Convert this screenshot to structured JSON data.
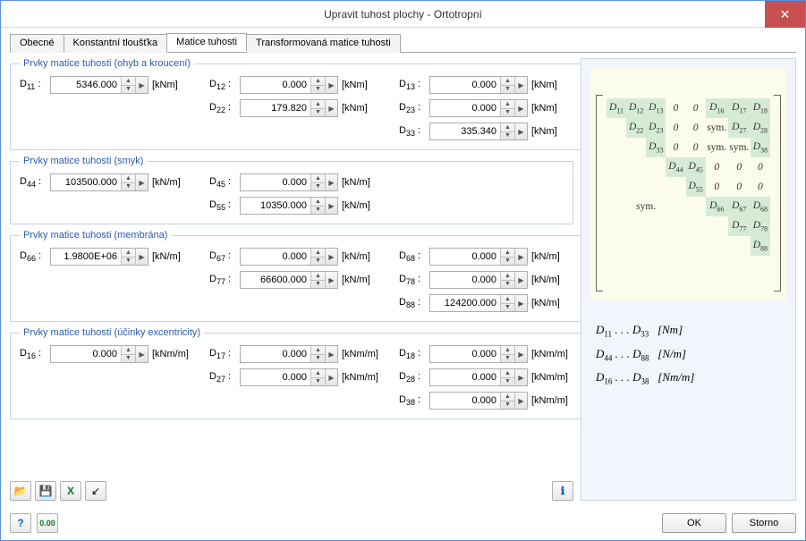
{
  "window": {
    "title": "Upravit tuhost plochy - Ortotropní"
  },
  "tabs": {
    "t0": "Obecné",
    "t1": "Konstantní tloušťka",
    "t2": "Matice tuhosti",
    "t3": "Transformovaná matice tuhosti"
  },
  "groups": {
    "bending": "Prvky matice tuhosti (ohyb a kroucení)",
    "shear": "Prvky matice tuhosti (smyk)",
    "membrane": "Prvky matice tuhosti (membrána)",
    "ecc": "Prvky matice tuhosti (účinky excentricity)"
  },
  "units": {
    "kNm": "[kNm]",
    "kNperm": "[kN/m]",
    "kNmperm": "[kNm/m]"
  },
  "labels": {
    "D11": "D",
    "D12": "D",
    "D13": "D",
    "D22": "D",
    "D23": "D",
    "D33": "D",
    "D44": "D",
    "D45": "D",
    "D55": "D",
    "D66": "D",
    "D67": "D",
    "D68": "D",
    "D77": "D",
    "D78": "D",
    "D88": "D",
    "D16": "D",
    "D17": "D",
    "D18": "D",
    "D27": "D",
    "D28": "D",
    "D38": "D"
  },
  "values": {
    "D11": "5346.000",
    "D12": "0.000",
    "D13": "0.000",
    "D22": "179.820",
    "D23": "0.000",
    "D33": "335.340",
    "D44": "103500.000",
    "D45": "0.000",
    "D55": "10350.000",
    "D66": "1.9800E+06",
    "D67": "0.000",
    "D68": "0.000",
    "D77": "66600.000",
    "D78": "0.000",
    "D88": "124200.000",
    "D16": "0.000",
    "D17": "0.000",
    "D18": "0.000",
    "D27": "0.000",
    "D28": "0.000",
    "D38": "0.000"
  },
  "matrix": {
    "sym": "sym."
  },
  "legend": {
    "l1a": "D",
    "l1b": " . . . D",
    "l1c": "   [Nm]",
    "l2a": "D",
    "l2b": " . . . D",
    "l2c": "   [N/m]",
    "l3a": "D",
    "l3b": " . . . D",
    "l3c": "   [Nm/m]"
  },
  "buttons": {
    "ok": "OK",
    "cancel": "Storno"
  }
}
